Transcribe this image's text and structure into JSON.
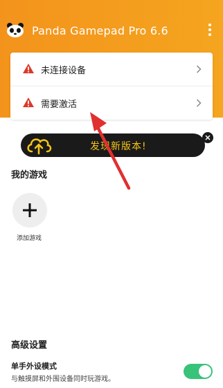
{
  "app": {
    "title": "Panda Gamepad Pro 6.6",
    "logo_icon": "panda-icon",
    "menu_icon": "more-vert-icon"
  },
  "status_cards": [
    {
      "label": "未连接设备",
      "icon": "warning-icon"
    },
    {
      "label": "需要激活",
      "icon": "warning-icon"
    }
  ],
  "banner": {
    "text": "发现新版本!",
    "icon": "cloud-upload-icon",
    "close_icon": "close-icon"
  },
  "my_games": {
    "title": "我的游戏",
    "add_label": "添加游戏"
  },
  "advanced": {
    "title": "高级设置",
    "single_hand": {
      "title": "单手外设模式",
      "description": "与触摸屏和外围设备同时玩游戏。",
      "enabled": true
    }
  },
  "colors": {
    "header": "#f3931c",
    "warning": "#d93a2b",
    "banner_bg": "#1a1a1a",
    "banner_text": "#f5c518",
    "toggle_on": "#39c27a",
    "arrow": "#e03030"
  }
}
